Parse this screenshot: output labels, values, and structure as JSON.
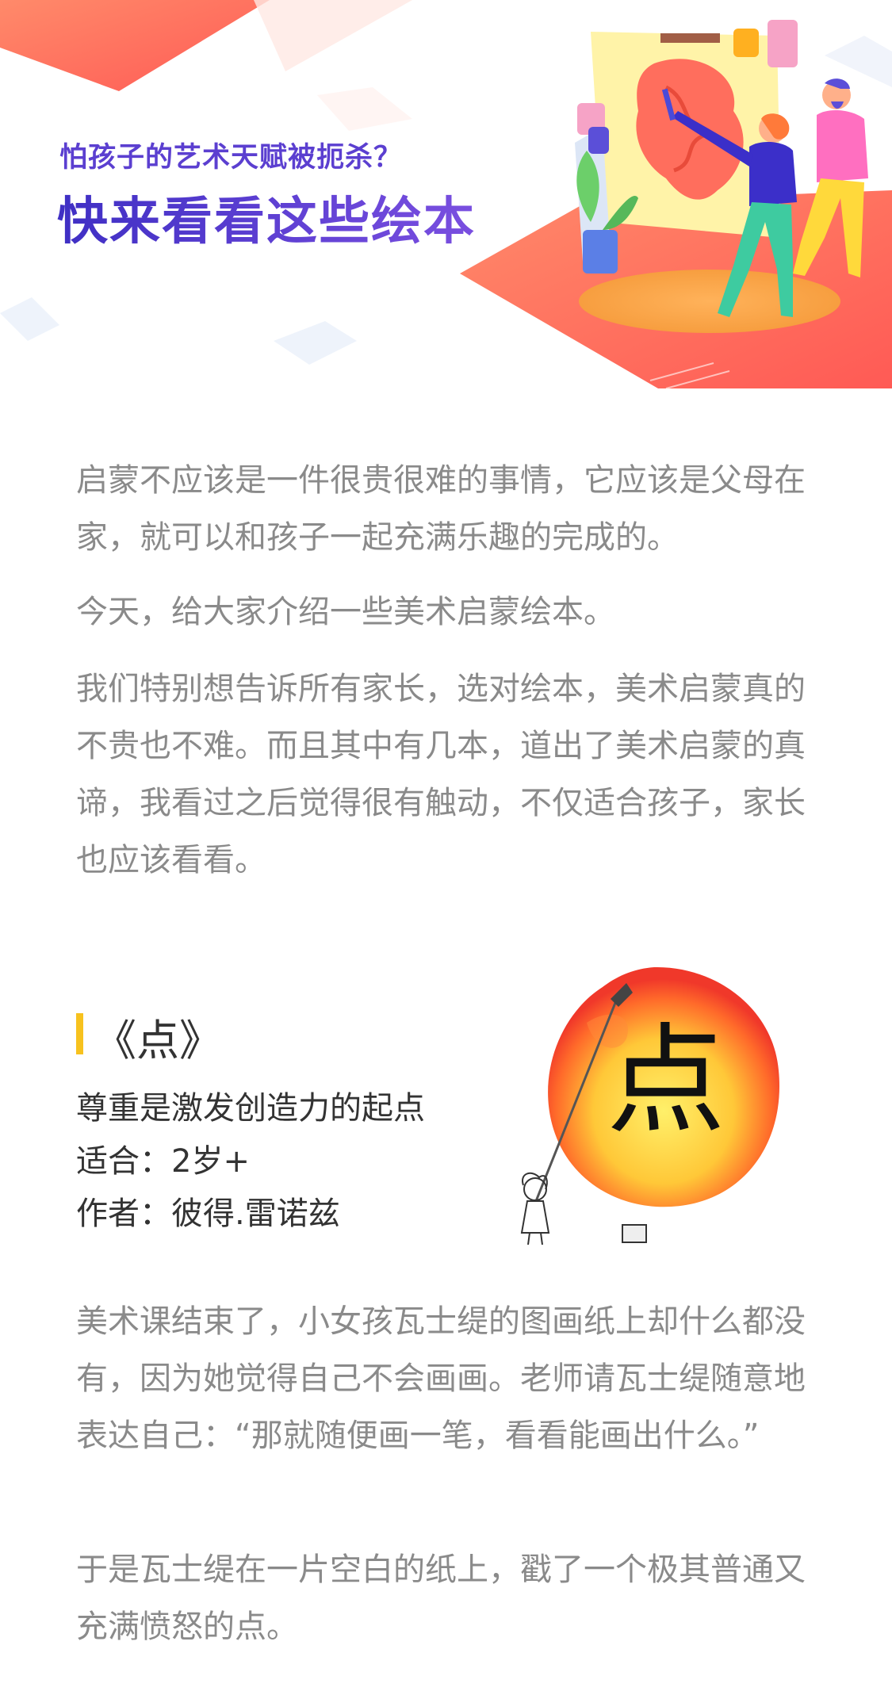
{
  "banner": {
    "subtitle": "怕孩子的艺术天赋被扼杀？",
    "title": "快来看看这些绘本",
    "colors": {
      "coral": "#ff6b5a",
      "purple": "#4f35c9",
      "yellow": "#fff3a8"
    }
  },
  "intro": {
    "paragraphs": [
      "启蒙不应该是一件很贵很难的事情，它应该是父母在家，就可以和孩子一起充满乐趣的完成的。",
      "今天，给大家介绍一些美术启蒙绘本。",
      "我们特别想告诉所有家长，选对绘本，美术启蒙真的不贵也不难。而且其中有几本，道出了美术启蒙的真谛，我看过之后觉得很有触动，不仅适合孩子，家长也应该看看。"
    ]
  },
  "book": {
    "title": "《点》",
    "tagline": "尊重是激发创造力的起点",
    "age": "适合：2岁+",
    "author": "作者：彼得.雷诺兹",
    "cover_char": "点",
    "accent_color": "#f7c21e"
  },
  "story": {
    "paragraphs": [
      "美术课结束了，小女孩瓦士缇的图画纸上却什么都没有，因为她觉得自己不会画画。老师请瓦士缇随意地表达自己：“那就随便画一笔，看看能画出什么。”",
      "于是瓦士缇在一片空白的纸上，戳了一个极其普通又充满愤怒的点。"
    ]
  }
}
